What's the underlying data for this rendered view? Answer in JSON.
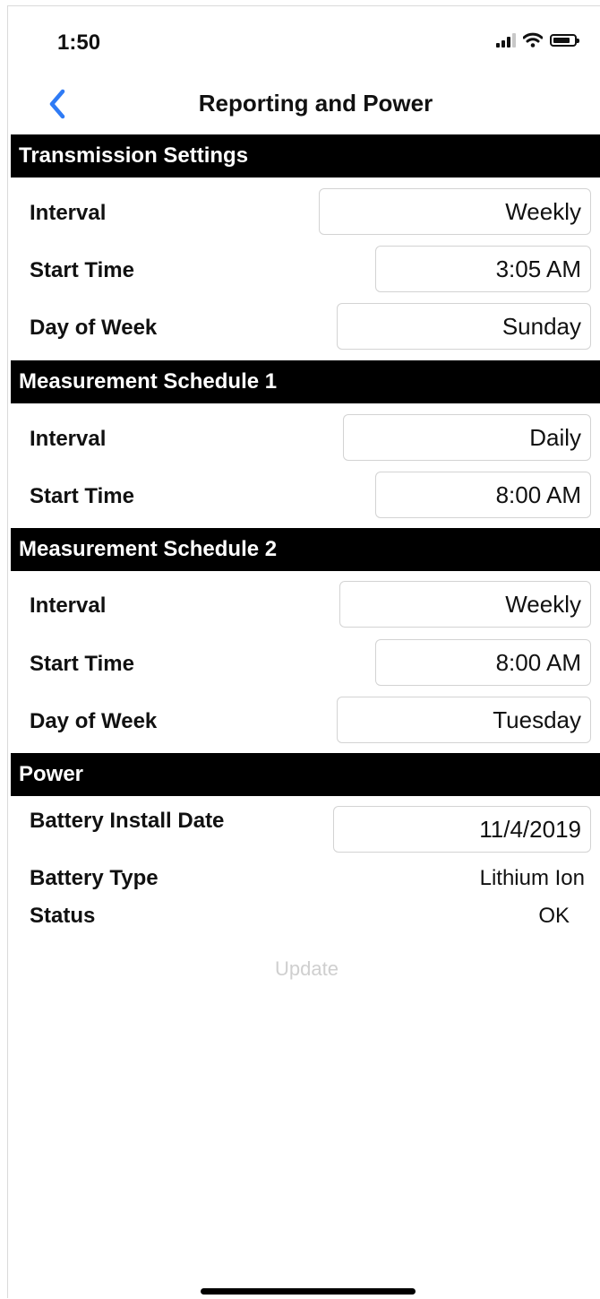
{
  "status_bar": {
    "time": "1:50"
  },
  "nav": {
    "title": "Reporting and Power"
  },
  "sections": {
    "transmission": {
      "title": "Transmission Settings",
      "interval_label": "Interval",
      "interval_value": "Weekly",
      "start_time_label": "Start Time",
      "start_time_value": "3:05 AM",
      "day_label": "Day of Week",
      "day_value": "Sunday"
    },
    "schedule1": {
      "title": "Measurement Schedule 1",
      "interval_label": "Interval",
      "interval_value": "Daily",
      "start_time_label": "Start Time",
      "start_time_value": "8:00 AM"
    },
    "schedule2": {
      "title": "Measurement Schedule 2",
      "interval_label": "Interval",
      "interval_value": "Weekly",
      "start_time_label": "Start Time",
      "start_time_value": "8:00 AM",
      "day_label": "Day of Week",
      "day_value": "Tuesday"
    },
    "power": {
      "title": "Power",
      "install_date_label": "Battery Install Date",
      "install_date_value": "11/4/2019",
      "battery_type_label": "Battery Type",
      "battery_type_value": "Lithium Ion",
      "status_label": "Status",
      "status_value": "OK"
    }
  },
  "actions": {
    "update_label": "Update"
  },
  "colors": {
    "accent": "#2f7bf5",
    "header_bg": "#000000",
    "disabled_text": "#cfcfcf"
  }
}
